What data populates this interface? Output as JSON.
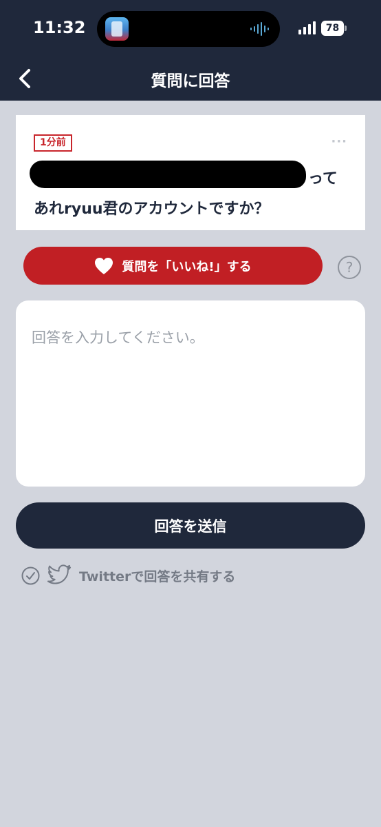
{
  "status_bar": {
    "time": "11:32",
    "battery": "78"
  },
  "nav": {
    "title": "質問に回答"
  },
  "question": {
    "time_badge": "1分前",
    "line1_suffix": "って",
    "line2": "あれryuu君のアカウントですか？",
    "more": "···"
  },
  "like": {
    "label": "質問を「いいね!」する",
    "help": "?"
  },
  "answer": {
    "placeholder": "回答を入力してください。",
    "value": ""
  },
  "submit": {
    "label": "回答を送信"
  },
  "share": {
    "label": "Twitterで回答を共有する"
  },
  "colors": {
    "header_bg": "#1f283b",
    "page_bg": "#d2d5dd",
    "accent_red": "#c11f24",
    "submit_bg": "#1f283b"
  },
  "icons": {
    "back": "chevron-left-icon",
    "heart": "heart-icon",
    "help": "question-circle-icon",
    "check": "check-circle-icon",
    "bird": "twitter-bird-icon"
  }
}
